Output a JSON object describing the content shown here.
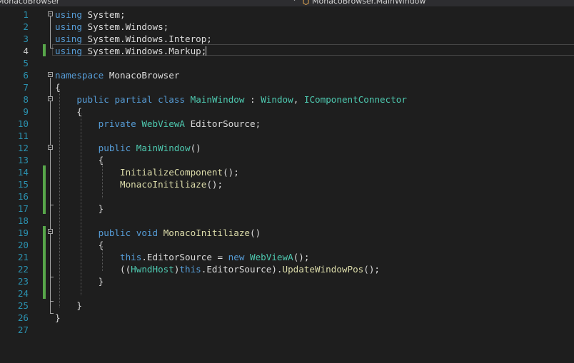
{
  "navbar": {
    "project": "MonacoBrowser",
    "member": "MonacoBrowser.MainWindow"
  },
  "editor": {
    "current_line": 4,
    "lines": [
      {
        "n": "1",
        "tokens": [
          {
            "t": "using",
            "c": "kw"
          },
          {
            "t": " System;",
            "c": "pl"
          }
        ]
      },
      {
        "n": "2",
        "tokens": [
          {
            "t": "using",
            "c": "kw"
          },
          {
            "t": " System.Windows;",
            "c": "pl"
          }
        ]
      },
      {
        "n": "3",
        "tokens": [
          {
            "t": "using",
            "c": "kw"
          },
          {
            "t": " System.Windows.Interop;",
            "c": "pl"
          }
        ]
      },
      {
        "n": "4",
        "tokens": [
          {
            "t": "using",
            "c": "kw"
          },
          {
            "t": " System.Windows.Markup;",
            "c": "pl"
          }
        ]
      },
      {
        "n": "5",
        "tokens": []
      },
      {
        "n": "6",
        "tokens": [
          {
            "t": "namespace",
            "c": "kw"
          },
          {
            "t": " MonacoBrowser",
            "c": "pl"
          }
        ]
      },
      {
        "n": "7",
        "tokens": [
          {
            "t": "{",
            "c": "pl"
          }
        ]
      },
      {
        "n": "8",
        "tokens": [
          {
            "t": "    ",
            "c": "pl"
          },
          {
            "t": "public",
            "c": "kw"
          },
          {
            "t": " ",
            "c": "pl"
          },
          {
            "t": "partial",
            "c": "kw"
          },
          {
            "t": " ",
            "c": "pl"
          },
          {
            "t": "class",
            "c": "kw"
          },
          {
            "t": " ",
            "c": "pl"
          },
          {
            "t": "MainWindow",
            "c": "ty"
          },
          {
            "t": " : ",
            "c": "pl"
          },
          {
            "t": "Window",
            "c": "ty"
          },
          {
            "t": ", ",
            "c": "pl"
          },
          {
            "t": "IComponentConnector",
            "c": "ty"
          }
        ]
      },
      {
        "n": "9",
        "tokens": [
          {
            "t": "    {",
            "c": "pl"
          }
        ]
      },
      {
        "n": "10",
        "tokens": [
          {
            "t": "        ",
            "c": "pl"
          },
          {
            "t": "private",
            "c": "kw"
          },
          {
            "t": " ",
            "c": "pl"
          },
          {
            "t": "WebViewA",
            "c": "ty"
          },
          {
            "t": " EditorSource;",
            "c": "pl"
          }
        ]
      },
      {
        "n": "11",
        "tokens": []
      },
      {
        "n": "12",
        "tokens": [
          {
            "t": "        ",
            "c": "pl"
          },
          {
            "t": "public",
            "c": "kw"
          },
          {
            "t": " ",
            "c": "pl"
          },
          {
            "t": "MainWindow",
            "c": "ty"
          },
          {
            "t": "()",
            "c": "pl"
          }
        ]
      },
      {
        "n": "13",
        "tokens": [
          {
            "t": "        {",
            "c": "pl"
          }
        ]
      },
      {
        "n": "14",
        "tokens": [
          {
            "t": "            ",
            "c": "pl"
          },
          {
            "t": "InitializeComponent",
            "c": "fn"
          },
          {
            "t": "();",
            "c": "pl"
          }
        ]
      },
      {
        "n": "15",
        "tokens": [
          {
            "t": "            ",
            "c": "pl"
          },
          {
            "t": "MonacoInitiliaze",
            "c": "fn"
          },
          {
            "t": "();",
            "c": "pl"
          }
        ]
      },
      {
        "n": "16",
        "tokens": []
      },
      {
        "n": "17",
        "tokens": [
          {
            "t": "        }",
            "c": "pl"
          }
        ]
      },
      {
        "n": "18",
        "tokens": []
      },
      {
        "n": "19",
        "tokens": [
          {
            "t": "        ",
            "c": "pl"
          },
          {
            "t": "public",
            "c": "kw"
          },
          {
            "t": " ",
            "c": "pl"
          },
          {
            "t": "void",
            "c": "kw"
          },
          {
            "t": " ",
            "c": "pl"
          },
          {
            "t": "MonacoInitiliaze",
            "c": "fn"
          },
          {
            "t": "()",
            "c": "pl"
          }
        ]
      },
      {
        "n": "20",
        "tokens": [
          {
            "t": "        {",
            "c": "pl"
          }
        ]
      },
      {
        "n": "21",
        "tokens": [
          {
            "t": "            ",
            "c": "pl"
          },
          {
            "t": "this",
            "c": "kw"
          },
          {
            "t": ".EditorSource = ",
            "c": "pl"
          },
          {
            "t": "new",
            "c": "kw"
          },
          {
            "t": " ",
            "c": "pl"
          },
          {
            "t": "WebViewA",
            "c": "ty"
          },
          {
            "t": "();",
            "c": "pl"
          }
        ]
      },
      {
        "n": "22",
        "tokens": [
          {
            "t": "            ((",
            "c": "pl"
          },
          {
            "t": "HwndHost",
            "c": "ty"
          },
          {
            "t": ")",
            "c": "pl"
          },
          {
            "t": "this",
            "c": "kw"
          },
          {
            "t": ".EditorSource).",
            "c": "pl"
          },
          {
            "t": "UpdateWindowPos",
            "c": "fn"
          },
          {
            "t": "();",
            "c": "pl"
          }
        ]
      },
      {
        "n": "23",
        "tokens": [
          {
            "t": "        }",
            "c": "pl"
          }
        ]
      },
      {
        "n": "24",
        "tokens": []
      },
      {
        "n": "25",
        "tokens": [
          {
            "t": "    }",
            "c": "pl"
          }
        ]
      },
      {
        "n": "26",
        "tokens": [
          {
            "t": "}",
            "c": "pl"
          }
        ]
      },
      {
        "n": "27",
        "tokens": []
      }
    ]
  },
  "colors": {
    "background": "#1e1e1e",
    "line_number": "#2b91af",
    "keyword": "#569cd6",
    "type": "#4ec9b0",
    "method": "#dcdcaa",
    "plain": "#dcdcdc",
    "change_marker": "#57a64a"
  }
}
